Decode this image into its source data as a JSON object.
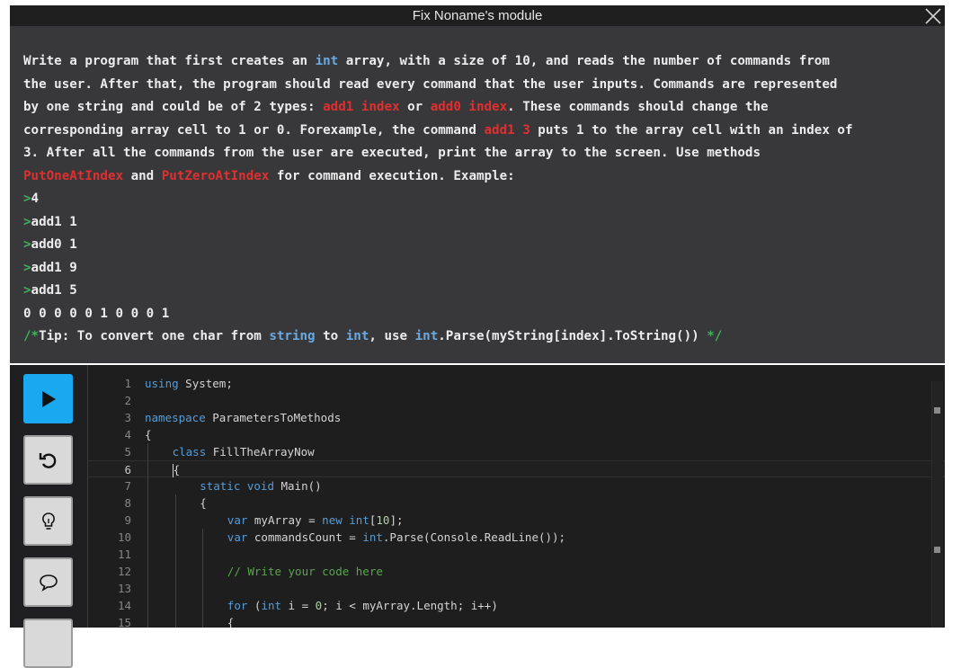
{
  "window": {
    "title": "Fix Noname's module",
    "close_icon": "close-icon"
  },
  "task": {
    "lines": [
      [
        {
          "t": "Write a program that first creates an "
        },
        {
          "t": "int",
          "c": "kw"
        },
        {
          "t": " array, with a size of 10, and reads the number of commands from"
        }
      ],
      [
        {
          "t": "the user. After that, the program should read every command that the user inputs. Commands are represented"
        }
      ],
      [
        {
          "t": "by one string and could be of 2 types: "
        },
        {
          "t": "add1 index",
          "c": "red"
        },
        {
          "t": " or "
        },
        {
          "t": "add0 index",
          "c": "red"
        },
        {
          "t": ". These commands should change the"
        }
      ],
      [
        {
          "t": "corresponding array cell to 1 or 0. Forexample, the command "
        },
        {
          "t": "add1 3",
          "c": "red"
        },
        {
          "t": " puts 1 to the array cell with an index of"
        }
      ],
      [
        {
          "t": "3. After all the commands from the user are executed, print the array to the screen. Use methods"
        }
      ],
      [
        {
          "t": "PutOneAtIndex",
          "c": "red"
        },
        {
          "t": " and "
        },
        {
          "t": "PutZeroAtIndex",
          "c": "red"
        },
        {
          "t": " for command execution. Example:"
        }
      ],
      [
        {
          "t": ">",
          "c": "grn"
        },
        {
          "t": "4"
        }
      ],
      [
        {
          "t": ">",
          "c": "grn"
        },
        {
          "t": "add1 1"
        }
      ],
      [
        {
          "t": ">",
          "c": "grn"
        },
        {
          "t": "add0 1"
        }
      ],
      [
        {
          "t": ">",
          "c": "grn"
        },
        {
          "t": "add1 9"
        }
      ],
      [
        {
          "t": ">",
          "c": "grn"
        },
        {
          "t": "add1 5"
        }
      ],
      [
        {
          "t": "0 0 0 0 0 1 0 0 0 1"
        }
      ],
      [
        {
          "t": "/*",
          "c": "grn"
        },
        {
          "t": "Tip: To convert one char from "
        },
        {
          "t": "string",
          "c": "kw"
        },
        {
          "t": " to "
        },
        {
          "t": "int",
          "c": "kw"
        },
        {
          "t": ", use "
        },
        {
          "t": "int",
          "c": "kw"
        },
        {
          "t": ".Parse(myString[index].ToString()) "
        },
        {
          "t": "*/",
          "c": "grn"
        }
      ]
    ]
  },
  "toolbar": {
    "buttons": [
      {
        "name": "run-button",
        "icon": "play-icon"
      },
      {
        "name": "reset-button",
        "icon": "reset-icon"
      },
      {
        "name": "hint-button",
        "icon": "lightbulb-icon"
      },
      {
        "name": "chat-button",
        "icon": "speech-bubble-icon"
      }
    ]
  },
  "editor": {
    "active_line": 6,
    "lines": [
      {
        "n": "1",
        "indent": 0,
        "tokens": [
          {
            "t": "using",
            "c": "ck"
          },
          {
            "t": " System;"
          }
        ]
      },
      {
        "n": "2",
        "indent": 0,
        "tokens": []
      },
      {
        "n": "3",
        "indent": 0,
        "tokens": [
          {
            "t": "namespace",
            "c": "ck"
          },
          {
            "t": " ParametersToMethods"
          }
        ]
      },
      {
        "n": "4",
        "indent": 0,
        "tokens": [
          {
            "t": "{"
          }
        ]
      },
      {
        "n": "5",
        "indent": 1,
        "tokens": [
          {
            "t": "class",
            "c": "ck"
          },
          {
            "t": " FillTheArrayNow"
          }
        ]
      },
      {
        "n": "6",
        "indent": 1,
        "tokens": [
          {
            "t": "{"
          }
        ],
        "caret": true
      },
      {
        "n": "7",
        "indent": 2,
        "tokens": [
          {
            "t": "static",
            "c": "ck"
          },
          {
            "t": " "
          },
          {
            "t": "void",
            "c": "ck"
          },
          {
            "t": " Main()"
          }
        ]
      },
      {
        "n": "8",
        "indent": 2,
        "tokens": [
          {
            "t": "{"
          }
        ]
      },
      {
        "n": "9",
        "indent": 3,
        "tokens": [
          {
            "t": "var",
            "c": "ck"
          },
          {
            "t": " myArray = "
          },
          {
            "t": "new",
            "c": "ck"
          },
          {
            "t": " "
          },
          {
            "t": "int",
            "c": "ck"
          },
          {
            "t": "["
          },
          {
            "t": "10",
            "c": "cn"
          },
          {
            "t": "];"
          }
        ]
      },
      {
        "n": "10",
        "indent": 3,
        "tokens": [
          {
            "t": "var",
            "c": "ck"
          },
          {
            "t": " commandsCount = "
          },
          {
            "t": "int",
            "c": "ck"
          },
          {
            "t": ".Parse(Console.ReadLine());"
          }
        ]
      },
      {
        "n": "11",
        "indent": 0,
        "tokens": []
      },
      {
        "n": "12",
        "indent": 3,
        "tokens": [
          {
            "t": "// Write your code here",
            "c": "cc"
          }
        ]
      },
      {
        "n": "13",
        "indent": 0,
        "tokens": []
      },
      {
        "n": "14",
        "indent": 3,
        "tokens": [
          {
            "t": "for",
            "c": "ck"
          },
          {
            "t": " ("
          },
          {
            "t": "int",
            "c": "ck"
          },
          {
            "t": " i = "
          },
          {
            "t": "0",
            "c": "cn"
          },
          {
            "t": "; i < myArray.Length; i++)"
          }
        ]
      },
      {
        "n": "15",
        "indent": 3,
        "tokens": [
          {
            "t": "{"
          }
        ]
      }
    ]
  }
}
